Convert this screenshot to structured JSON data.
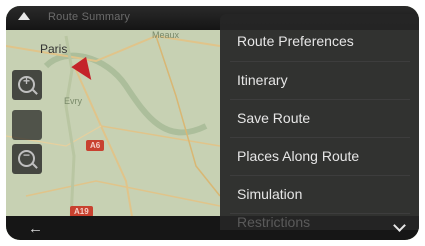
{
  "header": {
    "title": "Route Summary"
  },
  "map": {
    "cities": [
      {
        "name": "Paris"
      },
      {
        "name": "Meaux"
      },
      {
        "name": "Evry"
      }
    ],
    "road_badges": [
      "A6",
      "A19"
    ]
  },
  "zoom": {
    "zoom_in_symbol": "+",
    "zoom_out_symbol": "−"
  },
  "menu": {
    "items": [
      {
        "label": "Route Preferences",
        "enabled": true
      },
      {
        "label": "Itinerary",
        "enabled": true
      },
      {
        "label": "Save Route",
        "enabled": true
      },
      {
        "label": "Places Along Route",
        "enabled": true
      },
      {
        "label": "Simulation",
        "enabled": true
      },
      {
        "label": "Restrictions",
        "enabled": false
      }
    ]
  },
  "icons": {
    "top_left": "navigation-arrow-icon",
    "back": "back-arrow-icon",
    "expand": "chevron-down-icon"
  },
  "colors": {
    "route": "#c4232a",
    "menu_bg": "#262626",
    "text": "#e6e6e6",
    "disabled_text": "#5a5a5a"
  }
}
